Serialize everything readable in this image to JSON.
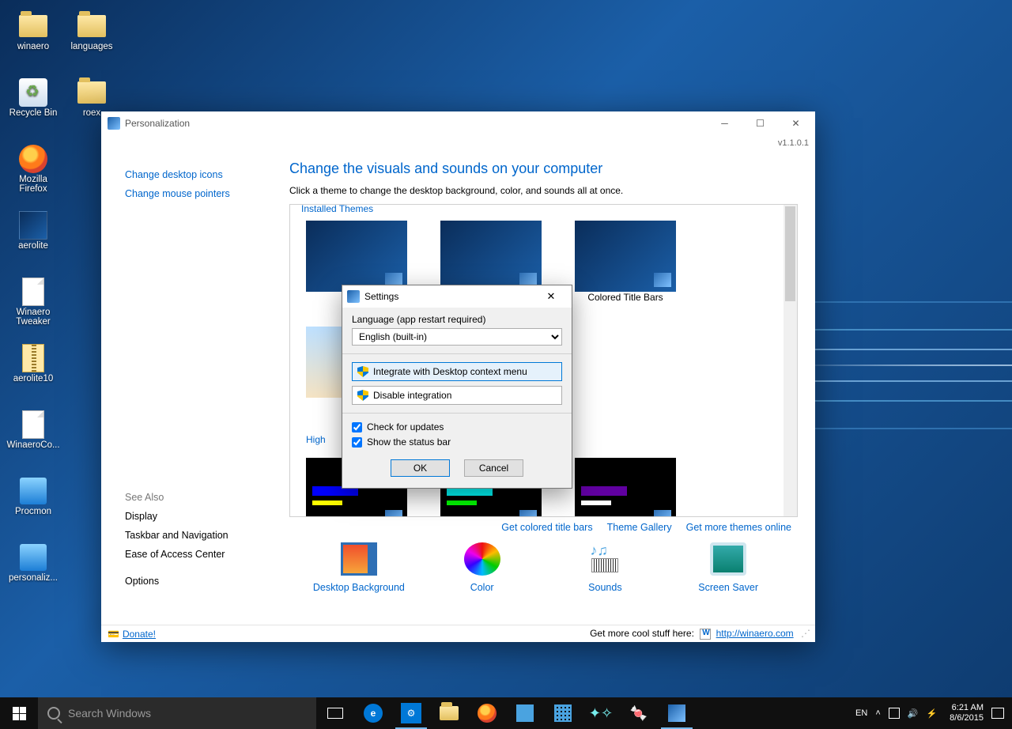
{
  "desktop": {
    "icons": [
      {
        "label": "winaero",
        "type": "folder"
      },
      {
        "label": "languages",
        "type": "folder"
      },
      {
        "label": "Recycle Bin",
        "type": "recycle"
      },
      {
        "label": "roex",
        "type": "folder"
      },
      {
        "label": "Mozilla Firefox",
        "type": "firefox"
      },
      {
        "label": "aerolite",
        "type": "shortcut"
      },
      {
        "label": "Winaero Tweaker",
        "type": "file"
      },
      {
        "label": "aerolite10",
        "type": "zip"
      },
      {
        "label": "WinaeroCo...",
        "type": "file"
      },
      {
        "label": "Procmon",
        "type": "exe"
      },
      {
        "label": "personaliz...",
        "type": "exe"
      }
    ]
  },
  "window": {
    "title": "Personalization",
    "version": "v1.1.0.1",
    "sidebar": {
      "links": [
        "Change desktop icons",
        "Change mouse pointers"
      ],
      "see_also_label": "See Also",
      "see_also": [
        "Display",
        "Taskbar and Navigation",
        "Ease of Access Center"
      ],
      "options": "Options"
    },
    "main": {
      "heading": "Change the visuals and sounds on your computer",
      "sub": "Click a theme to change the desktop background, color, and sounds all at once.",
      "installed_label": "Installed Themes",
      "themes": [
        "",
        "",
        "Colored Title Bars"
      ],
      "hc_label": "High",
      "links": [
        "Get colored title bars",
        "Theme Gallery",
        "Get more themes online"
      ],
      "bottom": [
        "Desktop Background",
        "Color",
        "Sounds",
        "Screen Saver"
      ]
    },
    "status": {
      "donate": "Donate!",
      "cool": "Get more cool stuff here:",
      "url": "http://winaero.com"
    }
  },
  "dialog": {
    "title": "Settings",
    "lang_label": "Language (app restart required)",
    "lang_value": "English (built-in)",
    "btn_integrate": "Integrate with Desktop context menu",
    "btn_disable": "Disable integration",
    "chk_updates": "Check for updates",
    "chk_status": "Show the status bar",
    "ok": "OK",
    "cancel": "Cancel"
  },
  "taskbar": {
    "search_placeholder": "Search Windows",
    "lang": "EN",
    "time": "6:21 AM",
    "date": "8/6/2015"
  }
}
